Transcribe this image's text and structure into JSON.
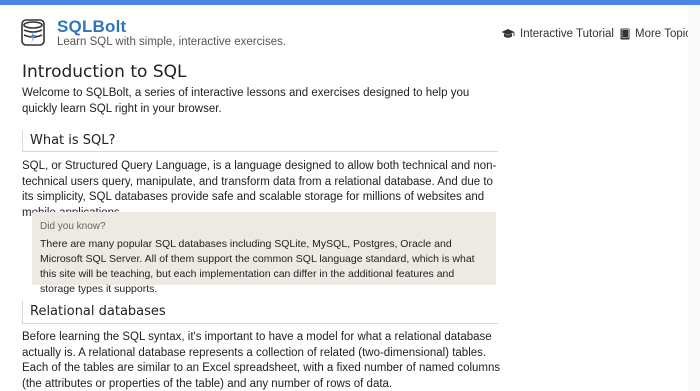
{
  "header": {
    "brand": "SQLBolt",
    "tagline": "Learn SQL with simple, interactive exercises.",
    "nav": [
      {
        "label": "Interactive Tutorial",
        "icon": "graduation-cap-icon"
      },
      {
        "label": "More Topics",
        "icon": "book-icon"
      }
    ]
  },
  "colors": {
    "accent": "#4a86e8",
    "brand": "#2f74c0",
    "note_bg": "#eceae3"
  },
  "main": {
    "title": "Introduction to SQL",
    "intro": "Welcome to SQLBolt, a series of interactive lessons and exercises designed to help you quickly learn SQL right in your browser.",
    "sections": [
      {
        "heading": "What is SQL?",
        "body": "SQL, or Structured Query Language, is a language designed to allow both technical and non-technical users query, manipulate, and transform data from a relational database. And due to its simplicity, SQL databases provide safe and scalable storage for millions of websites and mobile applications."
      },
      {
        "heading": "Relational databases",
        "body": "Before learning the SQL syntax, it's important to have a model for what a relational database actually is. A relational database represents a collection of related (two-dimensional) tables. Each of the tables are similar to an Excel spreadsheet, with a fixed number of named columns (the attributes or properties of the table) and any number of rows of data."
      }
    ],
    "note": {
      "label": "Did you know?",
      "text": "There are many popular SQL databases including SQLite, MySQL, Postgres, Oracle and Microsoft SQL Server. All of them support the common SQL language standard, which is what this site will be teaching, but each implementation can differ in the additional features and storage types it supports."
    }
  }
}
